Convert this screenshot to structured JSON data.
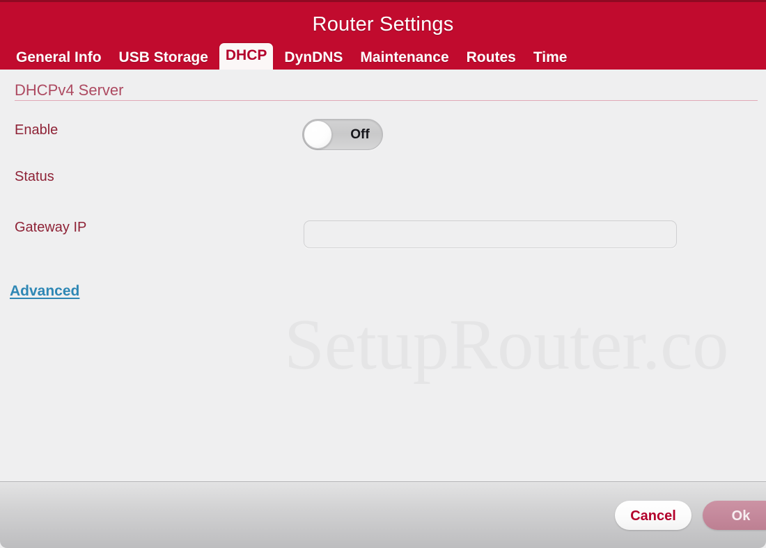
{
  "header": {
    "title": "Router Settings",
    "brand_color": "#c10b2e",
    "tabs": [
      {
        "label": "General Info",
        "active": false
      },
      {
        "label": "USB Storage",
        "active": false
      },
      {
        "label": "DHCP",
        "active": true
      },
      {
        "label": "DynDNS",
        "active": false
      },
      {
        "label": "Maintenance",
        "active": false
      },
      {
        "label": "Routes",
        "active": false
      },
      {
        "label": "Time",
        "active": false
      }
    ]
  },
  "content": {
    "section_heading": "DHCPv4 Server",
    "watermark": "SetupRouter.co",
    "fields": {
      "enable": {
        "label": "Enable",
        "toggle_state": "Off"
      },
      "status": {
        "label": "Status",
        "value": ""
      },
      "gateway_ip": {
        "label": "Gateway IP",
        "value": "",
        "placeholder": ""
      }
    },
    "advanced_link": "Advanced"
  },
  "footer": {
    "cancel_label": "Cancel",
    "ok_label": "Ok"
  }
}
